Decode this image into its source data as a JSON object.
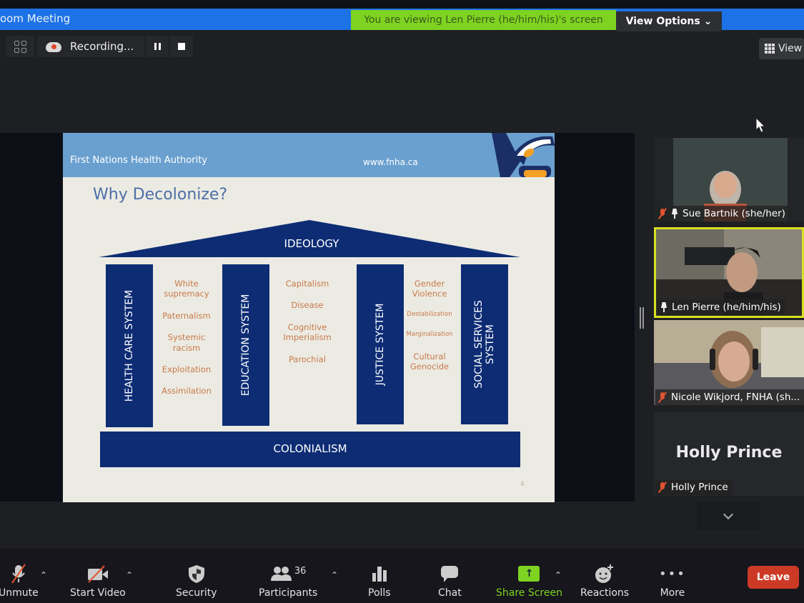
{
  "window": {
    "title": "oom Meeting",
    "viewing_banner": "You are viewing Len Pierre (he/him/his)'s screen",
    "view_options_label": "View Options",
    "view_button_label": "View"
  },
  "recording": {
    "label": "Recording...",
    "pause_icon": "pause-icon",
    "stop_icon": "stop-icon"
  },
  "slide": {
    "org_name": "First Nations Health Authority",
    "url": "www.fnha.ca",
    "title": "Why Decolonize?",
    "roof_label": "IDEOLOGY",
    "foundation_label": "COLONIALISM",
    "page_number": "4",
    "pillars": [
      {
        "label": "HEALTH CARE SYSTEM"
      },
      {
        "label": "EDUCATION SYSTEM"
      },
      {
        "label": "JUSTICE SYSTEM"
      },
      {
        "label": "SOCIAL SERVICES SYSTEM",
        "line1": "SOCIAL SERVICES",
        "line2": "SYSTEM"
      }
    ],
    "forces": [
      [
        "White supremacy",
        "Paternalism",
        "Systemic racism",
        "Exploitation",
        "Assimilation"
      ],
      [
        "Capitalism",
        "Disease",
        "Cognitive Imperialism",
        "Parochial"
      ],
      [
        "Gender Violence",
        "Destabilization",
        "Marginalization",
        "Cultural Genocide"
      ]
    ],
    "colors": {
      "header_blue": "#6aa0cf",
      "pillar_navy": "#0d2c74",
      "title_blue": "#4d6fa8",
      "force_orange": "#c8794a"
    }
  },
  "participants": [
    {
      "name": "Sue Bartnik (she/her)",
      "muted": true,
      "pinned": true
    },
    {
      "name": "Len Pierre (he/him/his)",
      "muted": false,
      "pinned": true,
      "active_speaker": true
    },
    {
      "name": "Nicole Wikjord, FNHA (sh...",
      "muted": true
    },
    {
      "name": "Holly Prince",
      "muted": true,
      "video_off": true,
      "display_name_big": "Holly Prince"
    }
  ],
  "toolbar": {
    "unmute": "Unmute",
    "start_video": "Start Video",
    "security": "Security",
    "participants": "Participants",
    "participants_count": "36",
    "polls": "Polls",
    "chat": "Chat",
    "share_screen": "Share Screen",
    "reactions": "Reactions",
    "more": "More",
    "leave": "Leave",
    "colors": {
      "share_green": "#7ed321",
      "leave_red": "#cc3a26",
      "active_border": "#d9e021"
    }
  }
}
